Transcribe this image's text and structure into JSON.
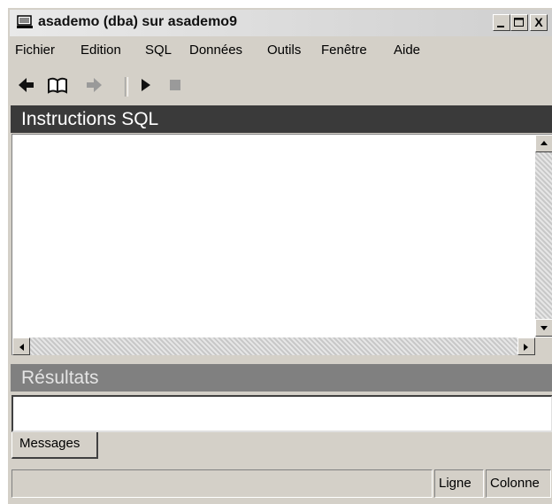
{
  "window": {
    "title": "asademo (dba) sur asademo9",
    "controls": [
      "minimize-icon",
      "maximize-icon",
      "close-icon"
    ],
    "close_label": "X"
  },
  "menu": [
    {
      "label": "Fichier"
    },
    {
      "label": "Edition"
    },
    {
      "label": "SQL"
    },
    {
      "label": "Données"
    },
    {
      "label": "Outils"
    },
    {
      "label": "Fenêtre"
    },
    {
      "label": "Aide"
    }
  ],
  "toolbar": {
    "icons": [
      "back-arrow-icon",
      "open-book-icon",
      "forward-arrow-icon",
      "run-icon",
      "stop-icon"
    ]
  },
  "sql_panel": {
    "header": "Instructions SQL",
    "content": ""
  },
  "results_panel": {
    "header": "Résultats",
    "content": "",
    "tabs": [
      {
        "label": "Messages"
      }
    ]
  },
  "status": {
    "message": "",
    "line_label": "Ligne",
    "column_label": "Colonne"
  }
}
